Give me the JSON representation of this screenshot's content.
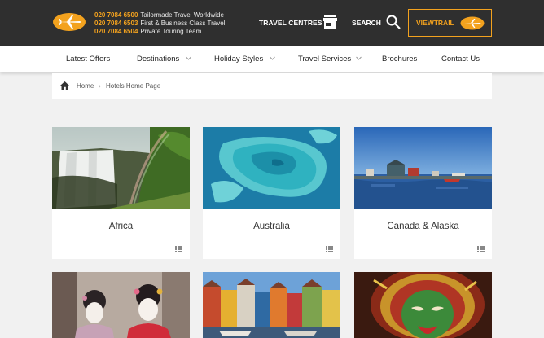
{
  "header": {
    "phones": [
      {
        "number": "020 7084 6500",
        "label": "Tailormade Travel Worldwide"
      },
      {
        "number": "020 7084 6503",
        "label": "First & Business Class Travel"
      },
      {
        "number": "020 7084 6504",
        "label": "Private Touring Team"
      }
    ],
    "travel_centres_label": "TRAVEL CENTRES",
    "search_label": "SEARCH",
    "viewtrail_label": "VIEWTRAIL",
    "accent_color": "#f3a21e",
    "bar_color": "#2f2f2f"
  },
  "nav": {
    "items": [
      {
        "label": "Latest Offers"
      },
      {
        "label": "Destinations"
      },
      {
        "label": "Holiday Styles"
      },
      {
        "label": "Travel Services"
      },
      {
        "label": "Brochures"
      },
      {
        "label": "Contact Us"
      }
    ]
  },
  "breadcrumb": {
    "home": "Home",
    "separator": "›",
    "current": "Hotels Home Page"
  },
  "cards": [
    {
      "title": "Africa",
      "image": "waterfall-with-rainbow"
    },
    {
      "title": "Australia",
      "image": "coral-reef-aerial"
    },
    {
      "title": "Canada & Alaska",
      "image": "fishing-village-harbour"
    },
    {
      "title": "",
      "image": "geisha-portraits"
    },
    {
      "title": "",
      "image": "colourful-harbour-houses"
    },
    {
      "title": "",
      "image": "kathakali-dancer"
    }
  ]
}
